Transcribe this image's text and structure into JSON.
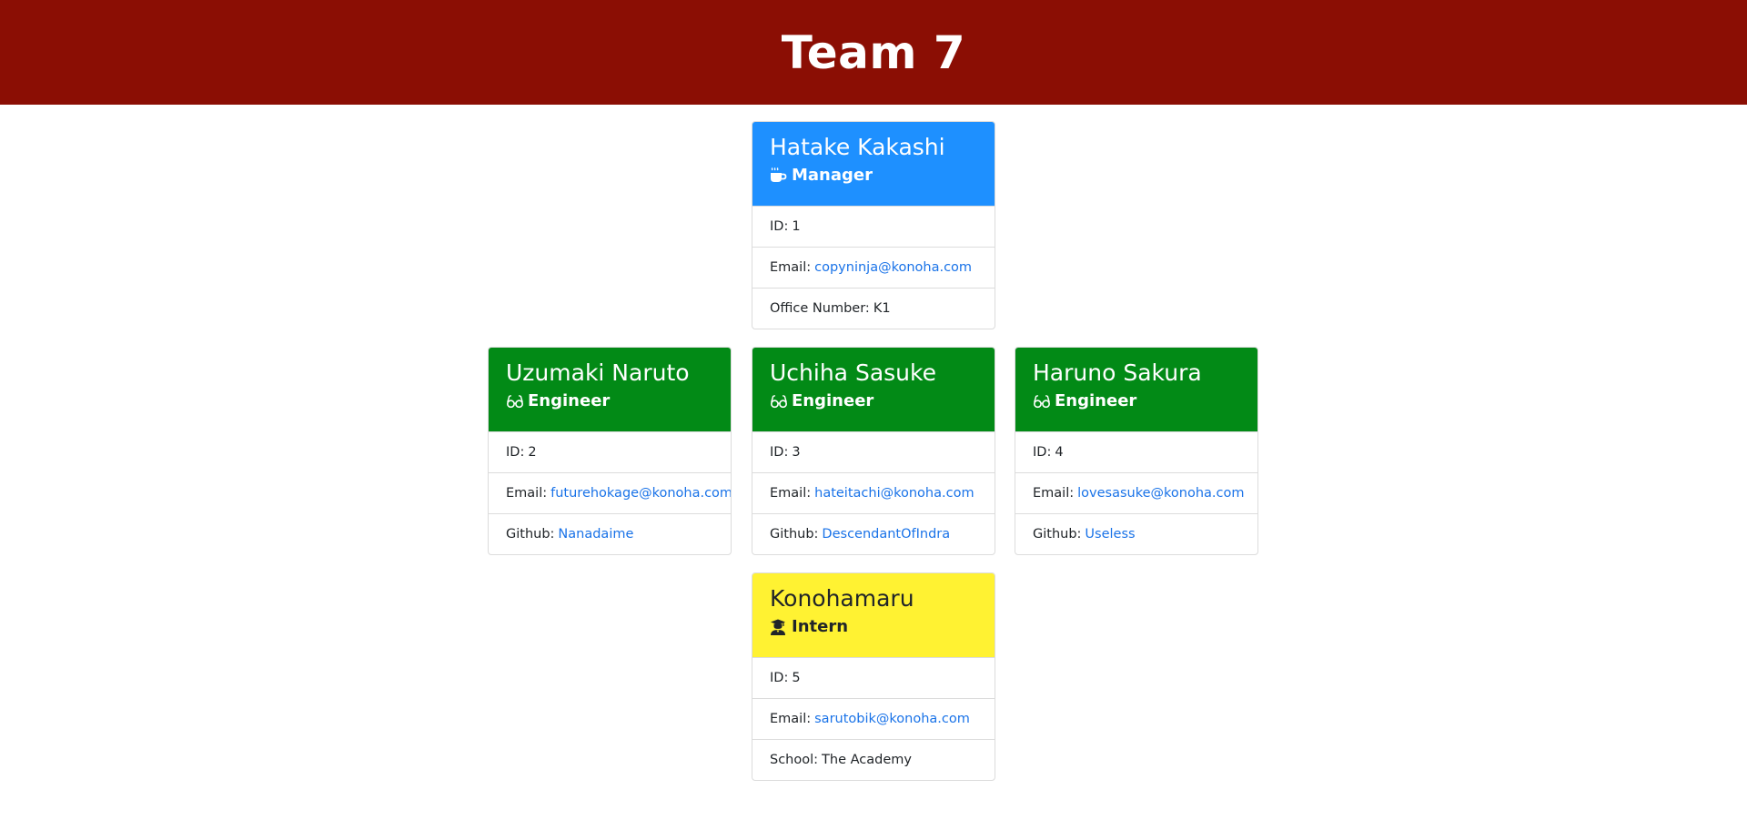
{
  "header": {
    "title": "Team 7"
  },
  "colors": {
    "header_bg": "#8b0e04",
    "manager": "#1e90ff",
    "engineer": "#028a16",
    "intern": "#fff232",
    "link": "#1a73e8"
  },
  "manager": {
    "name": "Hatake Kakashi",
    "role": "Manager",
    "icon": "mug-icon",
    "id_label": "ID:",
    "id": "1",
    "email_label": "Email:",
    "email": "copyninja@konoha.com",
    "extra_label": "Office Number:",
    "extra": "K1"
  },
  "engineers": [
    {
      "name": "Uzumaki Naruto",
      "role": "Engineer",
      "icon": "glasses-icon",
      "id_label": "ID:",
      "id": "2",
      "email_label": "Email:",
      "email": "futurehokage@konoha.com",
      "extra_label": "Github:",
      "extra": "Nanadaime"
    },
    {
      "name": "Uchiha Sasuke",
      "role": "Engineer",
      "icon": "glasses-icon",
      "id_label": "ID:",
      "id": "3",
      "email_label": "Email:",
      "email": "hateitachi@konoha.com",
      "extra_label": "Github:",
      "extra": "DescendantOfIndra"
    },
    {
      "name": "Haruno Sakura",
      "role": "Engineer",
      "icon": "glasses-icon",
      "id_label": "ID:",
      "id": "4",
      "email_label": "Email:",
      "email": "lovesasuke@konoha.com",
      "extra_label": "Github:",
      "extra": "Useless"
    }
  ],
  "intern": {
    "name": "Konohamaru",
    "role": "Intern",
    "icon": "graduate-icon",
    "id_label": "ID:",
    "id": "5",
    "email_label": "Email:",
    "email": "sarutobik@konoha.com",
    "extra_label": "School:",
    "extra": "The Academy"
  }
}
